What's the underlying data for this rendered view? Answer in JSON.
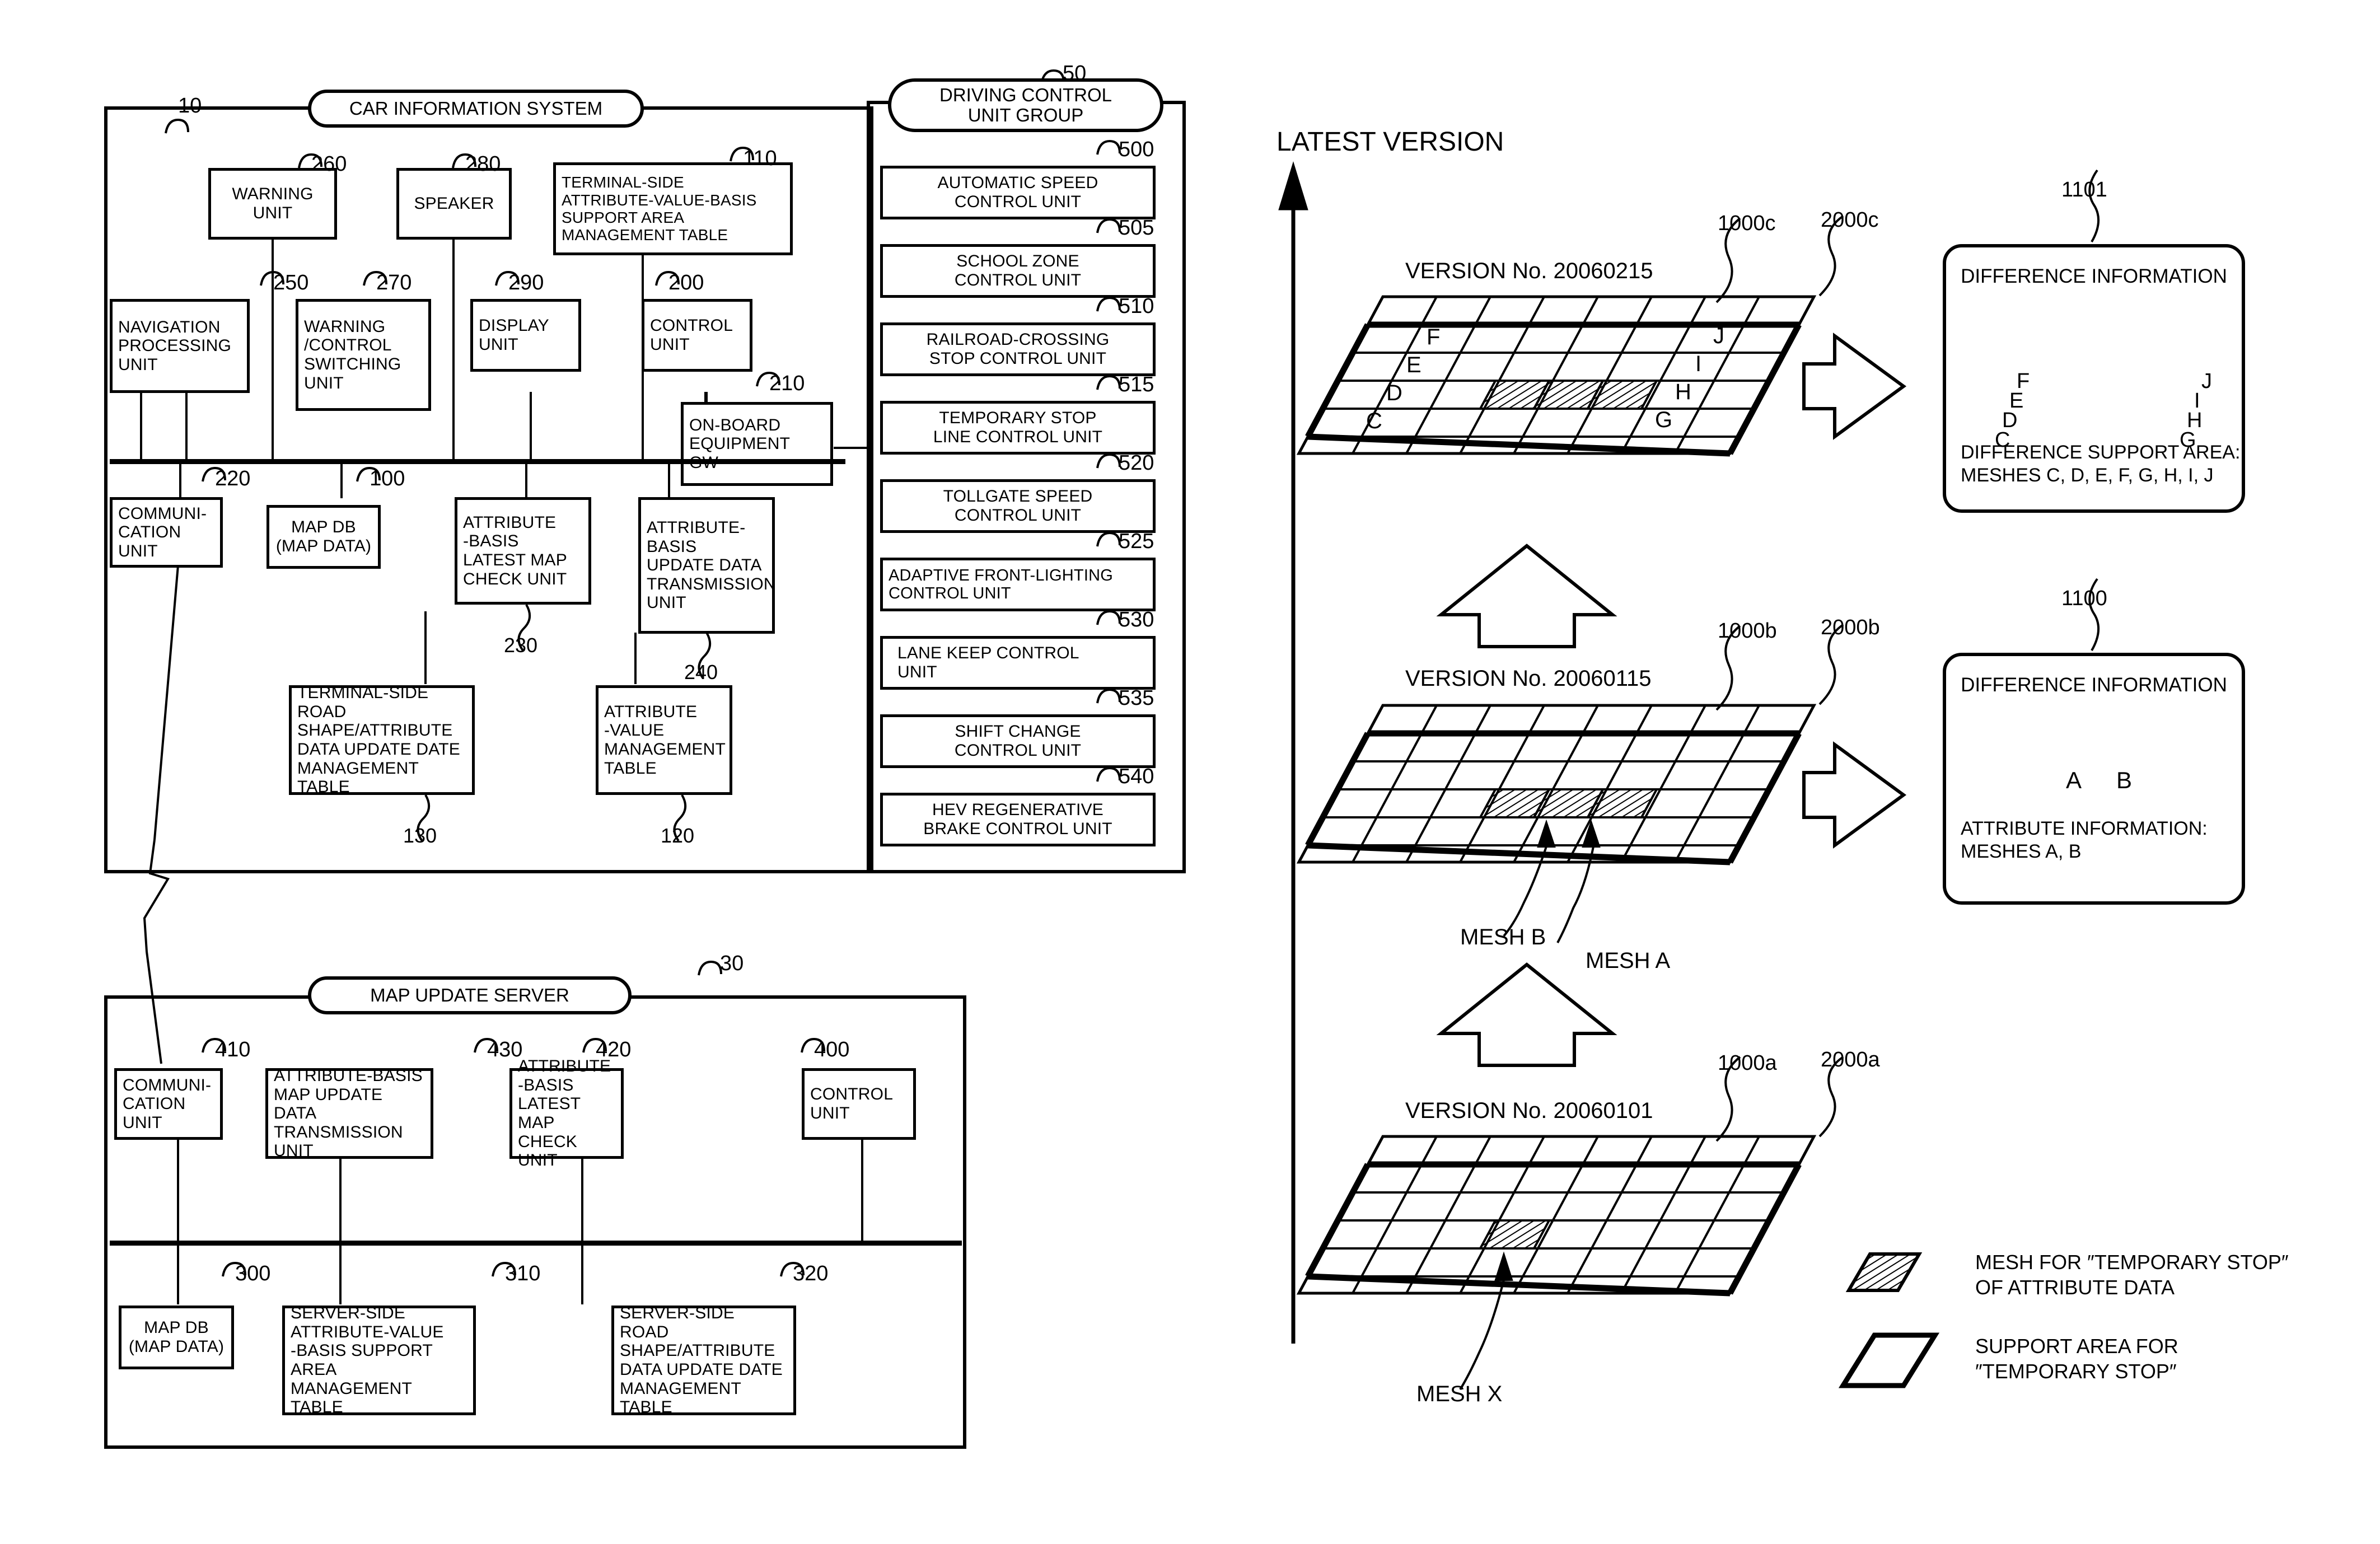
{
  "figure": {
    "left_panel_titles": {
      "car_information_system": "CAR INFORMATION SYSTEM",
      "car_information_system_ref": "10",
      "driving_control_unit_group": "DRIVING CONTROL\nUNIT GROUP",
      "driving_control_unit_group_ref": "50",
      "map_update_server": "MAP UPDATE SERVER",
      "map_update_server_ref": "30"
    },
    "car_system_blocks": [
      {
        "ref": "260",
        "label": "WARNING\nUNIT"
      },
      {
        "ref": "280",
        "label": "SPEAKER"
      },
      {
        "ref": "110",
        "label": "TERMINAL-SIDE\nATTRIBUTE-VALUE-BASIS\nSUPPORT AREA\nMANAGEMENT TABLE"
      },
      {
        "ref": "250",
        "label": "NAVIGATION\nPROCESSING\nUNIT"
      },
      {
        "ref": "270",
        "label": "WARNING\n/CONTROL\nSWITCHING\nUNIT"
      },
      {
        "ref": "290",
        "label": "DISPLAY\nUNIT"
      },
      {
        "ref": "200",
        "label": "CONTROL\nUNIT"
      },
      {
        "ref": "210",
        "label": "ON-BOARD\nEQUIPMENT\nGW"
      },
      {
        "ref": "220",
        "label": "COMMUNI-\nCATION\nUNIT"
      },
      {
        "ref": "100",
        "label": "MAP DB\n(MAP DATA)"
      },
      {
        "ref": "230",
        "label": "ATTRIBUTE\n-BASIS\nLATEST MAP\nCHECK UNIT"
      },
      {
        "ref": "240",
        "label": "ATTRIBUTE-\nBASIS\nUPDATE DATA\nTRANSMISSION\nUNIT"
      },
      {
        "ref": "130",
        "label": "TERMINAL-SIDE ROAD\nSHAPE/ATTRIBUTE\nDATA UPDATE DATE\nMANAGEMENT TABLE"
      },
      {
        "ref": "120",
        "label": "ATTRIBUTE\n-VALUE\nMANAGEMENT\nTABLE"
      }
    ],
    "driving_control_units": [
      {
        "ref": "500",
        "label": "AUTOMATIC SPEED\nCONTROL UNIT"
      },
      {
        "ref": "505",
        "label": "SCHOOL ZONE\nCONTROL UNIT"
      },
      {
        "ref": "510",
        "label": "RAILROAD-CROSSING\nSTOP CONTROL UNIT"
      },
      {
        "ref": "515",
        "label": "TEMPORARY STOP\nLINE CONTROL UNIT"
      },
      {
        "ref": "520",
        "label": "TOLLGATE SPEED\nCONTROL UNIT"
      },
      {
        "ref": "525",
        "label": "ADAPTIVE FRONT-LIGHTING\nCONTROL UNIT"
      },
      {
        "ref": "530",
        "label": "LANE KEEP CONTROL\nUNIT"
      },
      {
        "ref": "535",
        "label": "SHIFT CHANGE\nCONTROL UNIT"
      },
      {
        "ref": "540",
        "label": "HEV REGENERATIVE\nBRAKE CONTROL UNIT"
      }
    ],
    "server_blocks": [
      {
        "ref": "410",
        "label": "COMMUNI-\nCATION\nUNIT"
      },
      {
        "ref": "430",
        "label": "ATTRIBUTE-BASIS\nMAP UPDATE DATA\nTRANSMISSION UNIT"
      },
      {
        "ref": "420",
        "label": "ATTRIBUTE\n-BASIS\nLATEST MAP\nCHECK UNIT"
      },
      {
        "ref": "400",
        "label": "CONTROL\nUNIT"
      },
      {
        "ref": "300",
        "label": "MAP DB\n(MAP DATA)"
      },
      {
        "ref": "310",
        "label": "SERVER-SIDE\nATTRIBUTE-VALUE\n-BASIS SUPPORT AREA\nMANAGEMENT TABLE"
      },
      {
        "ref": "320",
        "label": "SERVER-SIDE ROAD\nSHAPE/ATTRIBUTE\nDATA UPDATE DATE\nMANAGEMENT TABLE"
      }
    ],
    "right_panel": {
      "axis_label": "LATEST VERSION",
      "planes": [
        {
          "id": "top",
          "version_text": "VERSION No. 20060215",
          "plane_ref": "1000c",
          "area_ref": "2000c",
          "mesh_letters": [
            "C",
            "D",
            "E",
            "F",
            "G",
            "H",
            "I",
            "J"
          ],
          "hatched_cells": 3
        },
        {
          "id": "middle",
          "version_text": "VERSION No. 20060115",
          "plane_ref": "1000b",
          "area_ref": "2000b",
          "callouts": [
            "MESH B",
            "MESH A"
          ],
          "hatched_cells": 3
        },
        {
          "id": "bottom",
          "version_text": "VERSION No. 20060101",
          "plane_ref": "1000a",
          "area_ref": "2000a",
          "callouts": [
            "MESH X"
          ],
          "hatched_cells": 1
        }
      ],
      "difference_cards": [
        {
          "ref": "1101",
          "title": "DIFFERENCE INFORMATION",
          "footer": "DIFFERENCE SUPPORT AREA:\nMESHES C, D, E, F, G, H, I, J",
          "left_stack": [
            "F",
            "E",
            "D",
            "C"
          ],
          "right_stack": [
            "J",
            "I",
            "H",
            "G"
          ]
        },
        {
          "ref": "1100",
          "title": "DIFFERENCE INFORMATION",
          "footer": "ATTRIBUTE INFORMATION:\nMESHES A, B",
          "cells": [
            "A",
            "B"
          ]
        }
      ],
      "legend": [
        {
          "icon": "hatched-parallelogram-icon",
          "text": "MESH FOR ″TEMPORARY STOP″\nOF ATTRIBUTE DATA"
        },
        {
          "icon": "outline-parallelogram-icon",
          "text": "SUPPORT AREA FOR\n″TEMPORARY STOP″"
        }
      ]
    }
  }
}
